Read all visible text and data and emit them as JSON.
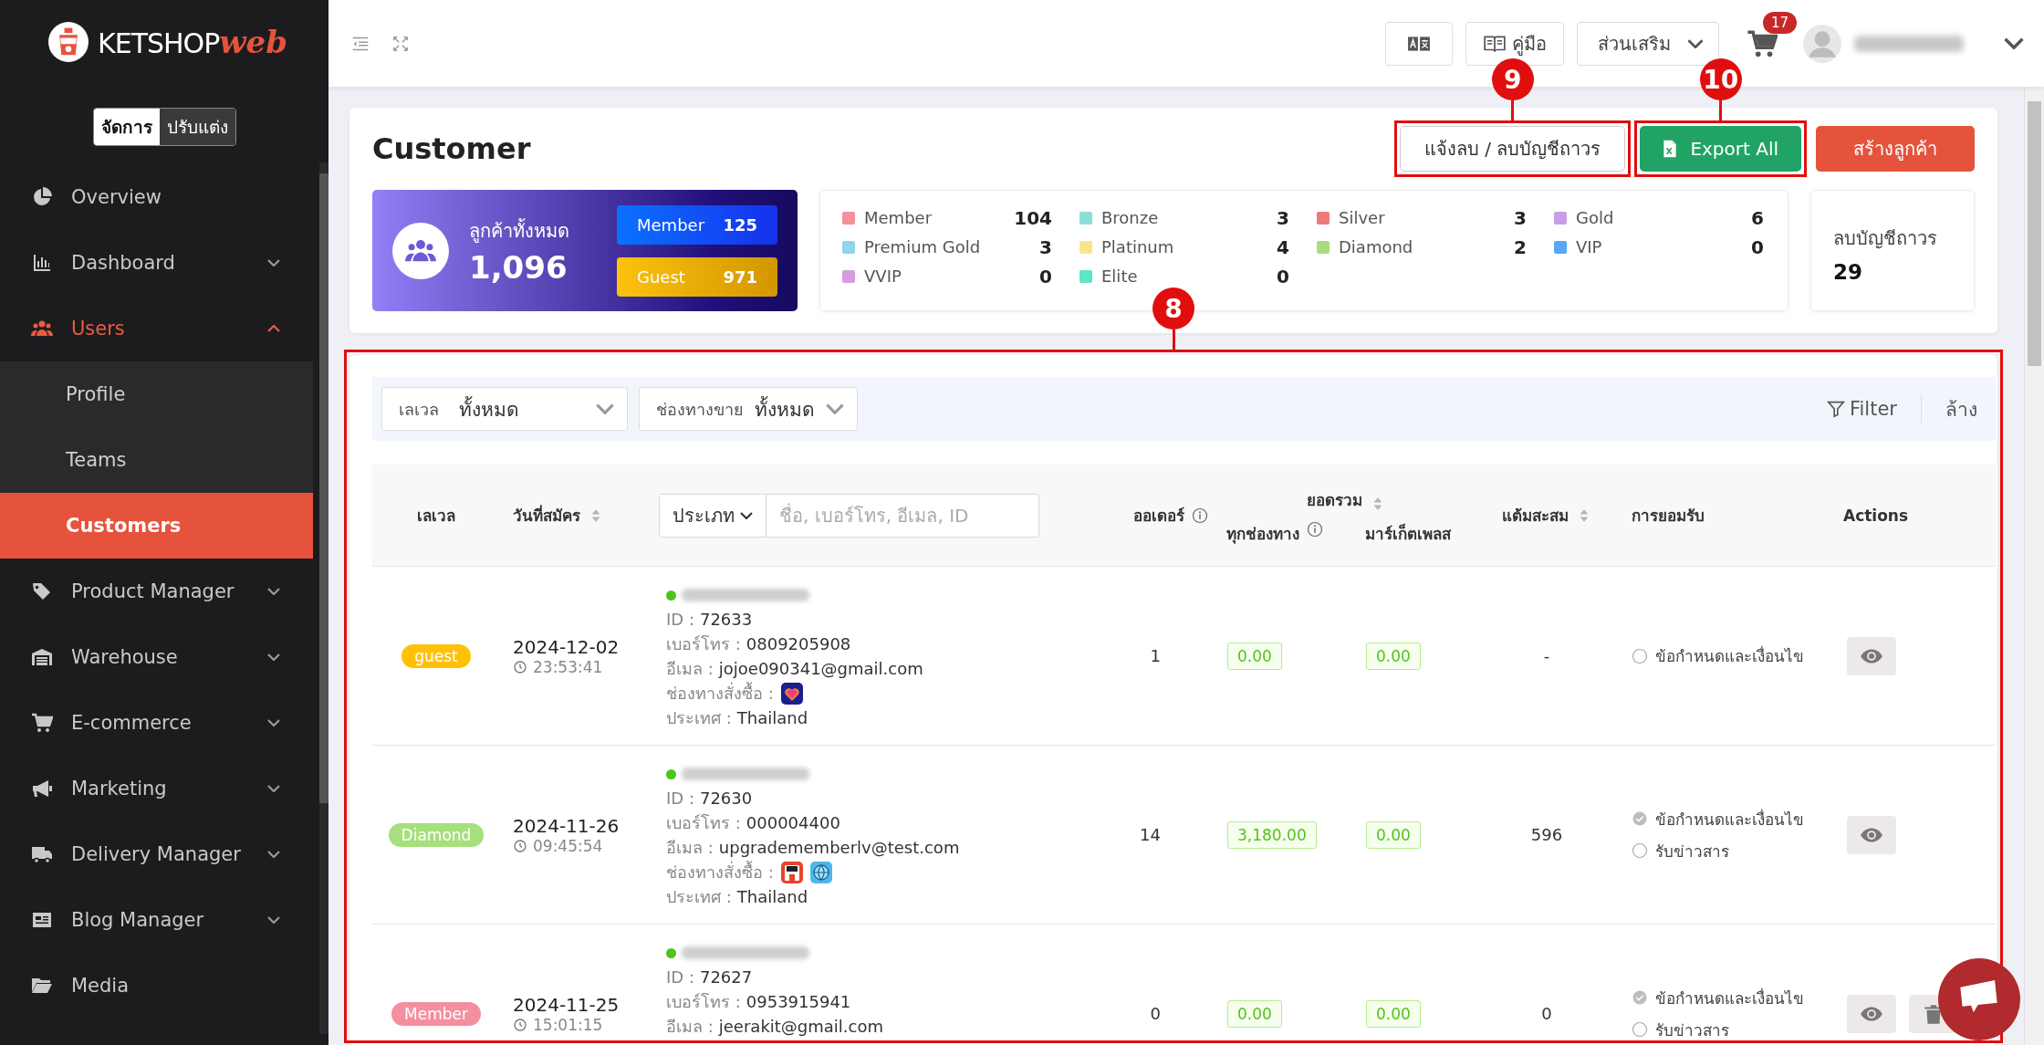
{
  "sidebar": {
    "logo": {
      "text": "KETSHOP",
      "accent": "web"
    },
    "mode_switch": [
      {
        "label": "จัดการ",
        "selected": true
      },
      {
        "label": "ปรับแต่ง",
        "selected": false
      }
    ],
    "items": [
      {
        "label": "Overview",
        "selected": false,
        "expandable": false,
        "expanded": false
      },
      {
        "label": "Dashboard",
        "selected": false,
        "expandable": true,
        "expanded": false
      },
      {
        "label": "Users",
        "selected": true,
        "expandable": true,
        "expanded": true,
        "children": [
          {
            "label": "Profile",
            "selected": false
          },
          {
            "label": "Teams",
            "selected": false
          },
          {
            "label": "Customers",
            "selected": true
          }
        ]
      },
      {
        "label": "Product Manager",
        "selected": false,
        "expandable": true,
        "expanded": false
      },
      {
        "label": "Warehouse",
        "selected": false,
        "expandable": true,
        "expanded": false
      },
      {
        "label": "E-commerce",
        "selected": false,
        "expandable": true,
        "expanded": false
      },
      {
        "label": "Marketing",
        "selected": false,
        "expandable": true,
        "expanded": false
      },
      {
        "label": "Delivery Manager",
        "selected": false,
        "expandable": true,
        "expanded": false
      },
      {
        "label": "Blog Manager",
        "selected": false,
        "expandable": true,
        "expanded": false
      },
      {
        "label": "Media",
        "selected": false,
        "expandable": false,
        "expanded": false
      }
    ]
  },
  "topbar": {
    "manual": "คู่มือ",
    "addons": "ส่วนเสริม",
    "cart_count": "17"
  },
  "page": {
    "title": "Customer",
    "actions": [
      {
        "kind": "outline",
        "label": "แจ้งลบ / ลบบัญชีถาวร",
        "callout": "9"
      },
      {
        "kind": "export",
        "label": "Export All",
        "callout": "10"
      },
      {
        "kind": "create",
        "label": "สร้างลูกค้า"
      }
    ],
    "summary": {
      "label": "ลูกค้าทั้งหมด",
      "total": "1,096",
      "groups": [
        {
          "kind": "member",
          "label": "Member",
          "count": "125"
        },
        {
          "kind": "guest",
          "label": "Guest",
          "count": "971"
        }
      ]
    },
    "levels": [
      {
        "name": "Member",
        "count": "104",
        "color": "#f4909c"
      },
      {
        "name": "Bronze",
        "count": "3",
        "color": "#8cded6"
      },
      {
        "name": "Silver",
        "count": "3",
        "color": "#ef7a7a"
      },
      {
        "name": "Gold",
        "count": "6",
        "color": "#c59fe8"
      },
      {
        "name": "Premium Gold",
        "count": "3",
        "color": "#8fd6ec"
      },
      {
        "name": "Platinum",
        "count": "4",
        "color": "#f9e68b"
      },
      {
        "name": "Diamond",
        "count": "2",
        "color": "#a8dd7f"
      },
      {
        "name": "VIP",
        "count": "0",
        "color": "#5aa6f7"
      },
      {
        "name": "VVIP",
        "count": "0",
        "color": "#d59ce0"
      },
      {
        "name": "Elite",
        "count": "0",
        "color": "#5ce6c8"
      }
    ],
    "deleted": {
      "label": "ลบบัญชีถาวร",
      "count": "29"
    }
  },
  "table_panel": {
    "callout": "8",
    "filters": [
      {
        "label": "เลเวล",
        "value": "ทั้งหมด"
      },
      {
        "label": "ช่องทางขาย",
        "value": "ทั้งหมด"
      }
    ],
    "filter_button": "Filter",
    "clear_button": "ล้าง",
    "columns": {
      "level": "เลเวล",
      "date": "วันที่สมัคร",
      "search_type": "ประเภท",
      "search_placeholder": "ชื่อ, เบอร์โทร, อีเมล, ID",
      "orders": "ออเดอร์",
      "total": "ยอดรวม",
      "all_channels": "ทุกช่องทาง",
      "marketplace": "มาร์เก็ตเพลส",
      "points": "แต้มสะสม",
      "consent": "การยอมรับ",
      "actions": "Actions"
    },
    "rows": [
      {
        "level": {
          "label": "guest",
          "color": "#ffc107"
        },
        "date": "2024-12-02",
        "time": "23:53:41",
        "online": true,
        "details": [
          {
            "label": "ID :",
            "value": "72633"
          },
          {
            "label": "เบอร์โทร :",
            "value": "0809205908"
          },
          {
            "label": "อีเมล :",
            "value": "jojoe090341@gmail.com"
          },
          {
            "label": "ช่องทางสั่งซื้อ :",
            "channels": [
              {
                "kind": "heart"
              }
            ]
          },
          {
            "label": "ประเทศ :",
            "value": "Thailand"
          }
        ],
        "orders": "1",
        "all_channels": "0.00",
        "marketplace": "0.00",
        "points": "-",
        "consents": [
          {
            "label": "ข้อกำหนดและเงื่อนไข",
            "checked": false
          }
        ],
        "actions": [
          {
            "kind": "view"
          }
        ]
      },
      {
        "level": {
          "label": "Diamond",
          "color": "#a6e07d"
        },
        "date": "2024-11-26",
        "time": "09:45:54",
        "online": true,
        "details": [
          {
            "label": "ID :",
            "value": "72630"
          },
          {
            "label": "เบอร์โทร :",
            "value": "000004400"
          },
          {
            "label": "อีเมล :",
            "value": "upgradememberlv@test.com"
          },
          {
            "label": "ช่องทางสั่งซื้อ :",
            "channels": [
              {
                "kind": "store"
              },
              {
                "kind": "globe"
              }
            ]
          },
          {
            "label": "ประเทศ :",
            "value": "Thailand"
          }
        ],
        "orders": "14",
        "all_channels": "3,180.00",
        "marketplace": "0.00",
        "points": "596",
        "consents": [
          {
            "label": "ข้อกำหนดและเงื่อนไข",
            "checked": true
          },
          {
            "label": "รับข่าวสาร",
            "checked": false
          }
        ],
        "actions": [
          {
            "kind": "view"
          }
        ]
      },
      {
        "level": {
          "label": "Member",
          "color": "#f48fa0"
        },
        "date": "2024-11-25",
        "time": "15:01:15",
        "online": true,
        "details": [
          {
            "label": "ID :",
            "value": "72627"
          },
          {
            "label": "เบอร์โทร :",
            "value": "0953915941"
          },
          {
            "label": "อีเมล :",
            "value": "jeerakit@gmail.com"
          }
        ],
        "orders": "0",
        "all_channels": "0.00",
        "marketplace": "0.00",
        "points": "0",
        "consents": [
          {
            "label": "ข้อกำหนดและเงื่อนไข",
            "checked": true
          },
          {
            "label": "รับข่าวสาร",
            "checked": false
          }
        ],
        "actions": [
          {
            "kind": "view"
          },
          {
            "kind": "delete"
          }
        ]
      }
    ]
  }
}
